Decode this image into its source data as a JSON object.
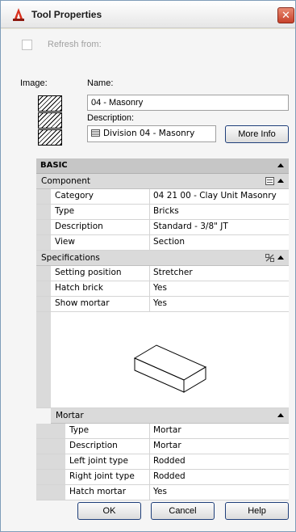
{
  "window": {
    "title": "Tool Properties",
    "close_glyph": "✕"
  },
  "refresh": {
    "label": "Refresh from:"
  },
  "image_label": "Image:",
  "name": {
    "label": "Name:",
    "value": "04 - Masonry"
  },
  "description": {
    "label": "Description:",
    "value": "Division 04 - Masonry"
  },
  "buttons": {
    "more_info": "More Info",
    "ok": "OK",
    "cancel": "Cancel",
    "help": "Help"
  },
  "sections": {
    "basic": "BASIC",
    "component": "Component",
    "specifications": "Specifications",
    "mortar": "Mortar"
  },
  "component_rows": [
    {
      "key": "Category",
      "value": "04 21 00 - Clay Unit Masonry"
    },
    {
      "key": "Type",
      "value": "Bricks"
    },
    {
      "key": "Description",
      "value": "Standard - 3/8\" JT"
    },
    {
      "key": "View",
      "value": "Section"
    }
  ],
  "spec_rows": [
    {
      "key": "Setting position",
      "value": "Stretcher"
    },
    {
      "key": "Hatch brick",
      "value": "Yes"
    },
    {
      "key": "Show mortar",
      "value": "Yes"
    }
  ],
  "mortar_rows": [
    {
      "key": "Type",
      "value": "Mortar"
    },
    {
      "key": "Description",
      "value": "Mortar"
    },
    {
      "key": "Left joint type",
      "value": "Rodded"
    },
    {
      "key": "Right joint type",
      "value": "Rodded"
    },
    {
      "key": "Hatch mortar",
      "value": "Yes"
    }
  ],
  "icons": {
    "app": "autocad-tool-icon",
    "close": "close-icon",
    "collapse": "collapse-arrow-icon",
    "list": "list-icon",
    "pick": "pick-point-icon"
  },
  "colors": {
    "accent_border": "#1f3f7a",
    "close_red": "#c7412a"
  }
}
